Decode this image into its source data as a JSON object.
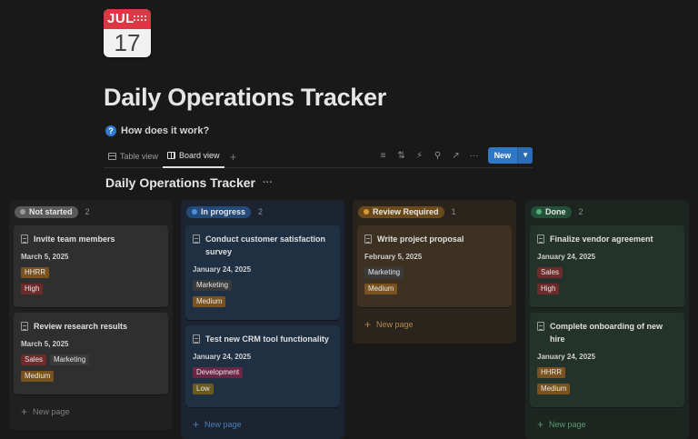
{
  "icon": {
    "month": "JUL",
    "day": "17",
    "name": "calendar-icon"
  },
  "page": {
    "title": "Daily Operations Tracker",
    "help_text": "How does it work?"
  },
  "views": {
    "tabs": [
      {
        "label": "Table view",
        "active": false
      },
      {
        "label": "Board view",
        "active": true
      }
    ],
    "new_label": "New"
  },
  "database": {
    "title": "Daily Operations Tracker"
  },
  "board": {
    "new_page_label": "New page",
    "columns": [
      {
        "label": "Not started",
        "count": "2",
        "colors": {
          "pill": "#5a5a5a",
          "dot": "#9b9b9b",
          "bg": "#202020",
          "card": "#2f2f2f",
          "newpage": "#7f7f7f"
        },
        "cards": [
          {
            "title": "Invite team members",
            "date": "March 5, 2025",
            "tags": [
              "HHRR"
            ],
            "priority": "High"
          },
          {
            "title": "Review research results",
            "date": "March 5, 2025",
            "tags": [
              "Sales",
              "Marketing"
            ],
            "priority": "Medium"
          }
        ]
      },
      {
        "label": "In progress",
        "count": "2",
        "colors": {
          "pill": "#234a78",
          "dot": "#4d8fe0",
          "bg": "#1b2430",
          "card": "#1f3043",
          "newpage": "#4a7fb8"
        },
        "cards": [
          {
            "title": "Conduct customer satisfaction survey",
            "date": "January 24, 2025",
            "tags": [
              "Marketing"
            ],
            "priority": "Medium"
          },
          {
            "title": "Test new CRM tool functionality",
            "date": "January 24, 2025",
            "tags": [
              "Development"
            ],
            "priority": "Low"
          }
        ]
      },
      {
        "label": "Review Required",
        "count": "1",
        "colors": {
          "pill": "#6a4a1a",
          "dot": "#d79a3a",
          "bg": "#2a241c",
          "card": "#3d3222",
          "newpage": "#b3894a"
        },
        "cards": [
          {
            "title": "Write project proposal",
            "date": "February 5, 2025",
            "tags": [
              "Marketing"
            ],
            "priority": "Medium"
          }
        ]
      },
      {
        "label": "Done",
        "count": "2",
        "colors": {
          "pill": "#24503a",
          "dot": "#4fae7a",
          "bg": "#1c2520",
          "card": "#243329",
          "newpage": "#5a9a74"
        },
        "cards": [
          {
            "title": "Finalize vendor agreement",
            "date": "January 24, 2025",
            "tags": [
              "Sales"
            ],
            "priority": "High"
          },
          {
            "title": "Complete onboarding of new hire",
            "date": "January 24, 2025",
            "tags": [
              "HHRR"
            ],
            "priority": "Medium"
          }
        ]
      }
    ],
    "tag_colors": {
      "HHRR": "#7a5220",
      "Sales": "#6e2b2b",
      "Marketing": "#3a3a3a",
      "Development": "#6b2545",
      "High": "#6e2b2b",
      "Medium": "#7a5220",
      "Low": "#6a5a1e"
    }
  }
}
